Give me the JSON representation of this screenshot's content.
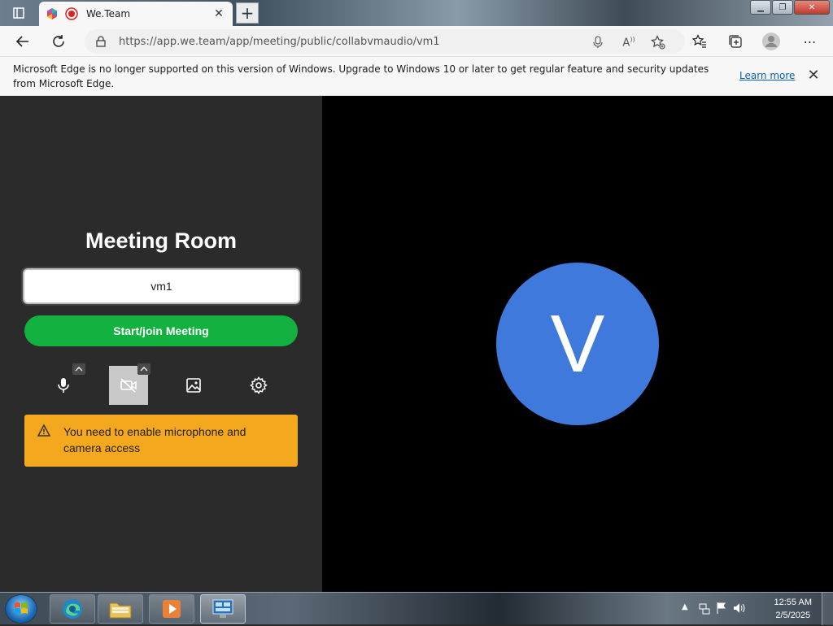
{
  "browser": {
    "tab": {
      "title": "We.Team"
    },
    "address": {
      "url": "https://app.we.team/app/meeting/public/collabvmaudio/vm1"
    },
    "infobar": {
      "message": "Microsoft Edge is no longer supported on this version of Windows. Upgrade to Windows 10 or later to get regular feature and security updates from Microsoft Edge.",
      "learn_more": "Learn more"
    }
  },
  "meeting": {
    "title": "Meeting Room",
    "room_input": {
      "value": "vm1"
    },
    "join_button": "Start/join Meeting",
    "controls": [
      "microphone-icon",
      "camera-off-icon",
      "background-image-icon",
      "settings-icon"
    ],
    "warning": "You need to enable microphone and camera access",
    "avatar_initial": "V"
  },
  "taskbar": {
    "time": "12:55 AM",
    "date": "2/5/2025"
  },
  "colors": {
    "join_button": "#13b240",
    "warning_bg": "#f4a81d",
    "avatar_bg": "#3f79dc",
    "left_panel": "#2b2b2b",
    "video_panel": "#000000"
  }
}
